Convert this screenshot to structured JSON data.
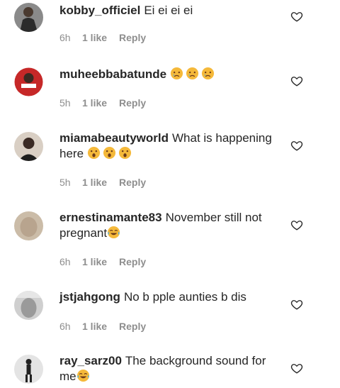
{
  "comments": [
    {
      "username": "kobby_officiel",
      "text": "Ei ei ei ei",
      "time": "6h",
      "likes": "1 like",
      "reply": "Reply",
      "emojis": [],
      "avatar_color": "#6b6b6b"
    },
    {
      "username": "muheebbabatunde",
      "text": "",
      "time": "5h",
      "likes": "1 like",
      "reply": "Reply",
      "emojis": [
        "crying-face",
        "crying-face",
        "crying-face"
      ],
      "avatar_color": "#c62828"
    },
    {
      "username": "miamabeautyworld",
      "text": "What is happening here",
      "time": "5h",
      "likes": "1 like",
      "reply": "Reply",
      "emojis": [
        "astonished-face",
        "astonished-face",
        "astonished-face"
      ],
      "avatar_color": "#3a2a24"
    },
    {
      "username": "ernestinamante83",
      "text": "November still not pregnant",
      "time": "6h",
      "likes": "1 like",
      "reply": "Reply",
      "emojis": [
        "tears-of-joy-face"
      ],
      "avatar_color": "#c9b9a6"
    },
    {
      "username": "jstjahgong",
      "text": "No b pple aunties b dis",
      "time": "6h",
      "likes": "1 like",
      "reply": "Reply",
      "emojis": [],
      "avatar_color": "#b0b0b0"
    },
    {
      "username": "ray_sarz00",
      "text": "The background sound for me",
      "time": "",
      "likes": "",
      "reply": "",
      "emojis": [
        "tears-of-joy-face"
      ],
      "avatar_color": "#e0e0e0"
    }
  ]
}
